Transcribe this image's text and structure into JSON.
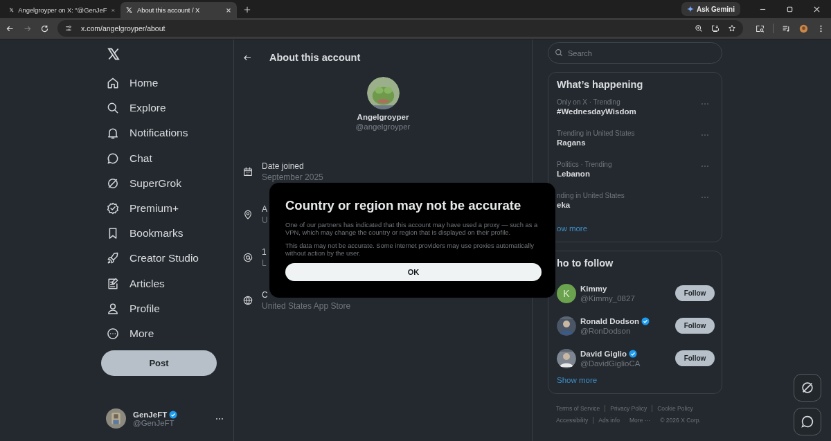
{
  "browser": {
    "tabs": [
      {
        "title": "Angelgroyper on X: \"@GenJeF",
        "selected": false
      },
      {
        "title": "About this account / X",
        "selected": true
      }
    ],
    "url": "x.com/angelgroyper/about",
    "ask_label": "Ask Gemini"
  },
  "sidebar": {
    "items": [
      {
        "label": "Home"
      },
      {
        "label": "Explore"
      },
      {
        "label": "Notifications"
      },
      {
        "label": "Chat"
      },
      {
        "label": "SuperGrok"
      },
      {
        "label": "Premium+"
      },
      {
        "label": "Bookmarks"
      },
      {
        "label": "Creator Studio"
      },
      {
        "label": "Articles"
      },
      {
        "label": "Profile"
      },
      {
        "label": "More"
      }
    ],
    "post_label": "Post",
    "account": {
      "name": "GenJeFT",
      "handle": "@GenJeFT",
      "verified": true
    }
  },
  "main": {
    "title": "About this account",
    "name": "Angelgroyper",
    "handle": "@angelgroyper",
    "details": [
      {
        "label": "Date joined",
        "value": "September 2025"
      },
      {
        "label": "A",
        "value": "U"
      },
      {
        "label": "1",
        "value": "L"
      },
      {
        "label": "C",
        "value": "United States App Store"
      }
    ]
  },
  "dialog": {
    "title": "Country or region may not be accurate",
    "paragraphs": [
      "One of our partners has indicated that this account may have used a proxy — such as a VPN, which may change the country or region that is displayed on their profile.",
      "This data may not be accurate. Some internet providers may use proxies automatically without action by the user."
    ],
    "ok_label": "OK"
  },
  "right": {
    "search_placeholder": "Search",
    "trends": {
      "title": "What’s happening",
      "items": [
        {
          "context": "Only on X · Trending",
          "topic": "#WednesdayWisdom"
        },
        {
          "context": "Trending in United States",
          "topic": "Ragans"
        },
        {
          "context": "Politics · Trending",
          "topic": "Lebanon"
        },
        {
          "context": "nding in United States",
          "topic": "eka"
        }
      ],
      "show_more": "ow more"
    },
    "follow": {
      "title": "ho to follow",
      "users": [
        {
          "name": "Kimmy",
          "handle": "@Kimmy_0827",
          "verified": false,
          "initial": "K",
          "button": "Follow"
        },
        {
          "name": "Ronald Dodson",
          "handle": "@RonDodson",
          "verified": true,
          "button": "Follow"
        },
        {
          "name": "David Giglio",
          "handle": "@DavidGiglioCA",
          "verified": true,
          "button": "Follow"
        }
      ],
      "show_more": "Show more"
    },
    "footer": [
      "Terms of Service",
      "Privacy Policy",
      "Cookie Policy",
      "Accessibility",
      "Ads info",
      "More ···",
      "© 2026 X Corp."
    ]
  }
}
